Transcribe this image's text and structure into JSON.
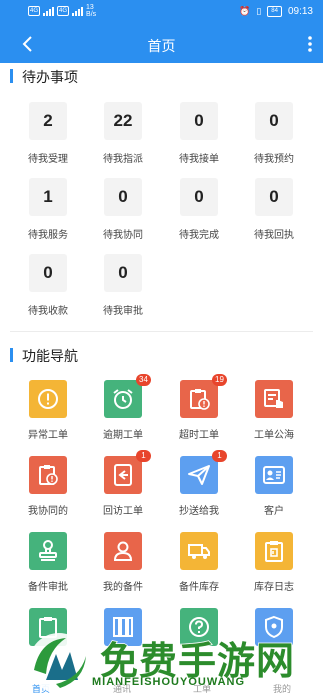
{
  "status": {
    "net_left": "4G",
    "net_mid": "4G",
    "speed": "13\nB/s",
    "battery": "84",
    "time": "09:13"
  },
  "navbar": {
    "title": "首页"
  },
  "todo": {
    "title": "待办事项",
    "items": [
      {
        "count": "2",
        "label": "待我受理"
      },
      {
        "count": "22",
        "label": "待我指派"
      },
      {
        "count": "0",
        "label": "待我接单"
      },
      {
        "count": "0",
        "label": "待我预约"
      },
      {
        "count": "1",
        "label": "待我服务"
      },
      {
        "count": "0",
        "label": "待我协同"
      },
      {
        "count": "0",
        "label": "待我完成"
      },
      {
        "count": "0",
        "label": "待我回执"
      },
      {
        "count": "0",
        "label": "待我收款"
      },
      {
        "count": "0",
        "label": "待我审批"
      }
    ]
  },
  "functions": {
    "title": "功能导航",
    "items": [
      {
        "label": "异常工单",
        "icon": "alert-circle-icon",
        "color": "#f4b536",
        "badge": ""
      },
      {
        "label": "逾期工单",
        "icon": "alarm-clock-icon",
        "color": "#45b37c",
        "badge": "34"
      },
      {
        "label": "超时工单",
        "icon": "overtime-clipboard-icon",
        "color": "#e8654a",
        "badge": "19"
      },
      {
        "label": "工单公海",
        "icon": "hand-pointer-icon",
        "color": "#e8654a",
        "badge": ""
      },
      {
        "label": "我协同的",
        "icon": "clipboard-alert-icon",
        "color": "#e8654a",
        "badge": ""
      },
      {
        "label": "回访工单",
        "icon": "phone-callback-icon",
        "color": "#e8654a",
        "badge": "1"
      },
      {
        "label": "抄送给我",
        "icon": "paper-plane-icon",
        "color": "#5d9ff0",
        "badge": "1"
      },
      {
        "label": "客户",
        "icon": "contact-card-icon",
        "color": "#5d9ff0",
        "badge": ""
      },
      {
        "label": "备件审批",
        "icon": "stamp-icon",
        "color": "#45b37c",
        "badge": ""
      },
      {
        "label": "我的备件",
        "icon": "person-icon",
        "color": "#e8654a",
        "badge": ""
      },
      {
        "label": "备件库存",
        "icon": "truck-icon",
        "color": "#f4b536",
        "badge": ""
      },
      {
        "label": "库存日志",
        "icon": "log-clipboard-icon",
        "color": "#f4b536",
        "badge": ""
      }
    ]
  },
  "bottom_tabs": [
    "首页",
    "通讯",
    "工单",
    "我的"
  ],
  "watermark": {
    "big": "免费手游网",
    "small": "MIANFEISHOUYOUWANG"
  }
}
